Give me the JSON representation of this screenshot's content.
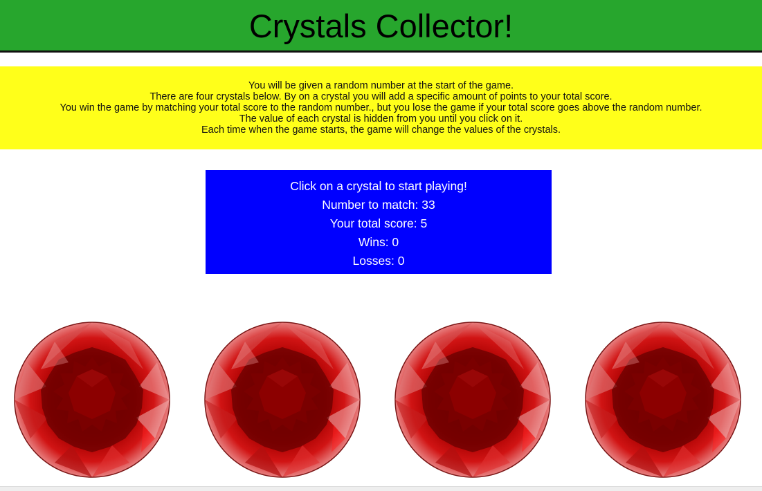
{
  "header": {
    "title": "Crystals Collector!"
  },
  "instructions": {
    "lines": [
      "You will be given a random number at the start of the game.",
      "There are four crystals below. By on a crystal you will add a specific amount of points to your total score.",
      "You win the game by matching your total score to the random number., but you lose the game if your total score goes above the random number.",
      "The value of each crystal is hidden from you until you click on it.",
      "Each time when the game starts, the game will change the values of the crystals."
    ]
  },
  "scoreboard": {
    "prompt": "Click on a crystal to start playing!",
    "target_line": "Number to match: 33",
    "score_line": "Your total score: 5",
    "wins_line": "Wins: 0",
    "losses_line": "Losses: 0"
  },
  "crystals": [
    {
      "icon": "red-crystal-icon"
    },
    {
      "icon": "red-crystal-icon"
    },
    {
      "icon": "red-crystal-icon"
    },
    {
      "icon": "red-crystal-icon"
    }
  ],
  "colors": {
    "header_bg": "#27a62d",
    "instructions_bg": "#ffff1a",
    "scoreboard_bg": "#0000ff",
    "crystal_red": "#c00000"
  }
}
